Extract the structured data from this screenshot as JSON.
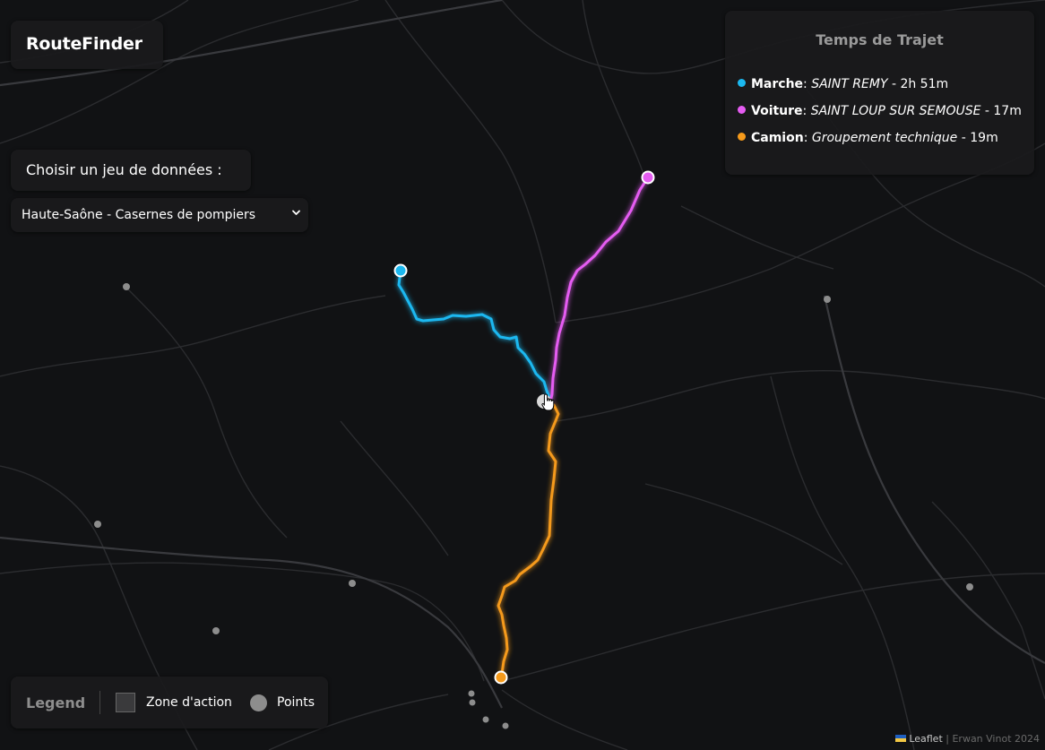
{
  "app": {
    "title": "RouteFinder"
  },
  "dataset": {
    "label": "Choisir un jeu de données :",
    "selected": "Haute-Saône - Casernes de pompiers"
  },
  "travel_time": {
    "title": "Temps de Trajet",
    "rows": [
      {
        "mode": "Marche",
        "destination": "SAINT REMY",
        "duration": " - 2h 51m",
        "color": "#1bb8f0"
      },
      {
        "mode": "Voiture",
        "destination": "SAINT LOUP SUR SEMOUSE",
        "duration": " - 17m",
        "color": "#e55cf2"
      },
      {
        "mode": "Camion",
        "destination": "Groupement technique ",
        "duration": " - 19m",
        "color": "#f59a1b"
      }
    ]
  },
  "legend": {
    "title": "Legend",
    "zone_label": "Zone d'action",
    "points_label": "Points"
  },
  "attribution": {
    "leaflet": "Leaflet",
    "separator": " | ",
    "credit": "Erwan Vinot 2024"
  },
  "colors": {
    "walk": "#1bb8f0",
    "car": "#e55cf2",
    "truck": "#f59a1b",
    "background": "#111214"
  }
}
